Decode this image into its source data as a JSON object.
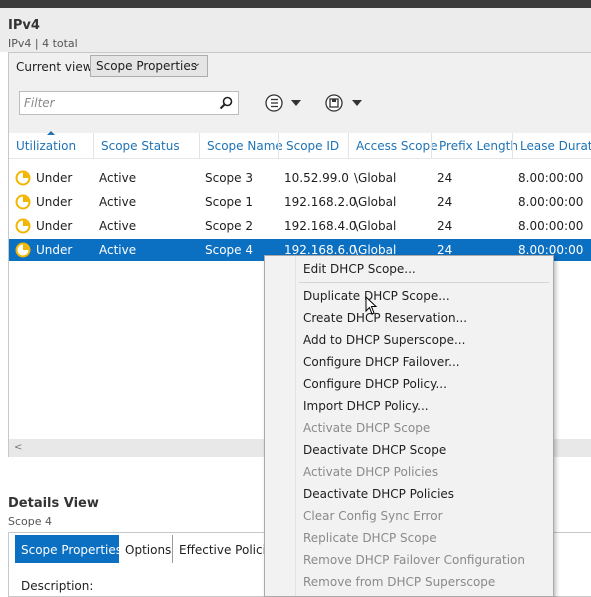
{
  "header": {
    "title": "IPv4",
    "subtitle": "IPv4 | 4 total"
  },
  "toolbar": {
    "current_view_label": "Current view:",
    "current_view_value": "Scope Properties",
    "filter_placeholder": "Filter",
    "icons": [
      "search-icon",
      "list-options-icon",
      "save-icon"
    ]
  },
  "grid": {
    "columns": [
      "Utilization",
      "Scope Status",
      "Scope Name",
      "Scope ID",
      "Access Scope",
      "Prefix Length",
      "Lease Duration"
    ],
    "sort_column": "Utilization",
    "rows": [
      {
        "utilization": "Under",
        "status": "Active",
        "name": "Scope 3",
        "id": "10.52.99.0",
        "access": "\\Global",
        "prefix": "24",
        "lease": "8.00:00:00"
      },
      {
        "utilization": "Under",
        "status": "Active",
        "name": "Scope 1",
        "id": "192.168.2.0",
        "access": "\\Global",
        "prefix": "24",
        "lease": "8.00:00:00"
      },
      {
        "utilization": "Under",
        "status": "Active",
        "name": "Scope 2",
        "id": "192.168.4.0",
        "access": "\\Global",
        "prefix": "24",
        "lease": "8.00:00:00"
      },
      {
        "utilization": "Under",
        "status": "Active",
        "name": "Scope 4",
        "id": "192.168.6.0",
        "access": "\\Global",
        "prefix": "24",
        "lease": "8.00:00:00"
      }
    ],
    "selected_row": 3
  },
  "details": {
    "title": "Details View",
    "subtitle": "Scope 4",
    "tabs": [
      "Scope Properties",
      "Options",
      "Effective Policies"
    ],
    "active_tab": "Scope Properties",
    "description_label": "Description:"
  },
  "context_menu": {
    "items": [
      {
        "label": "Edit DHCP Scope...",
        "enabled": true
      },
      {
        "label": "Duplicate DHCP Scope...",
        "enabled": true
      },
      {
        "label": "Create DHCP Reservation...",
        "enabled": true
      },
      {
        "label": "Add to DHCP Superscope...",
        "enabled": true
      },
      {
        "label": "Configure DHCP Failover...",
        "enabled": true
      },
      {
        "label": "Configure DHCP Policy...",
        "enabled": true
      },
      {
        "label": "Import DHCP Policy...",
        "enabled": true
      },
      {
        "label": "Activate DHCP Scope",
        "enabled": false
      },
      {
        "label": "Deactivate DHCP Scope",
        "enabled": true
      },
      {
        "label": "Activate DHCP Policies",
        "enabled": false
      },
      {
        "label": "Deactivate DHCP Policies",
        "enabled": true
      },
      {
        "label": "Clear Config Sync Error",
        "enabled": false
      },
      {
        "label": "Replicate DHCP Scope",
        "enabled": false
      },
      {
        "label": "Remove DHCP Failover Configuration",
        "enabled": false
      },
      {
        "label": "Remove from DHCP Superscope",
        "enabled": false
      }
    ]
  },
  "colors": {
    "accent": "#0b6fc2",
    "header_text": "#1e73b7",
    "disabled_text": "#8a8a8a",
    "utilization_icon": "#f2b600"
  }
}
